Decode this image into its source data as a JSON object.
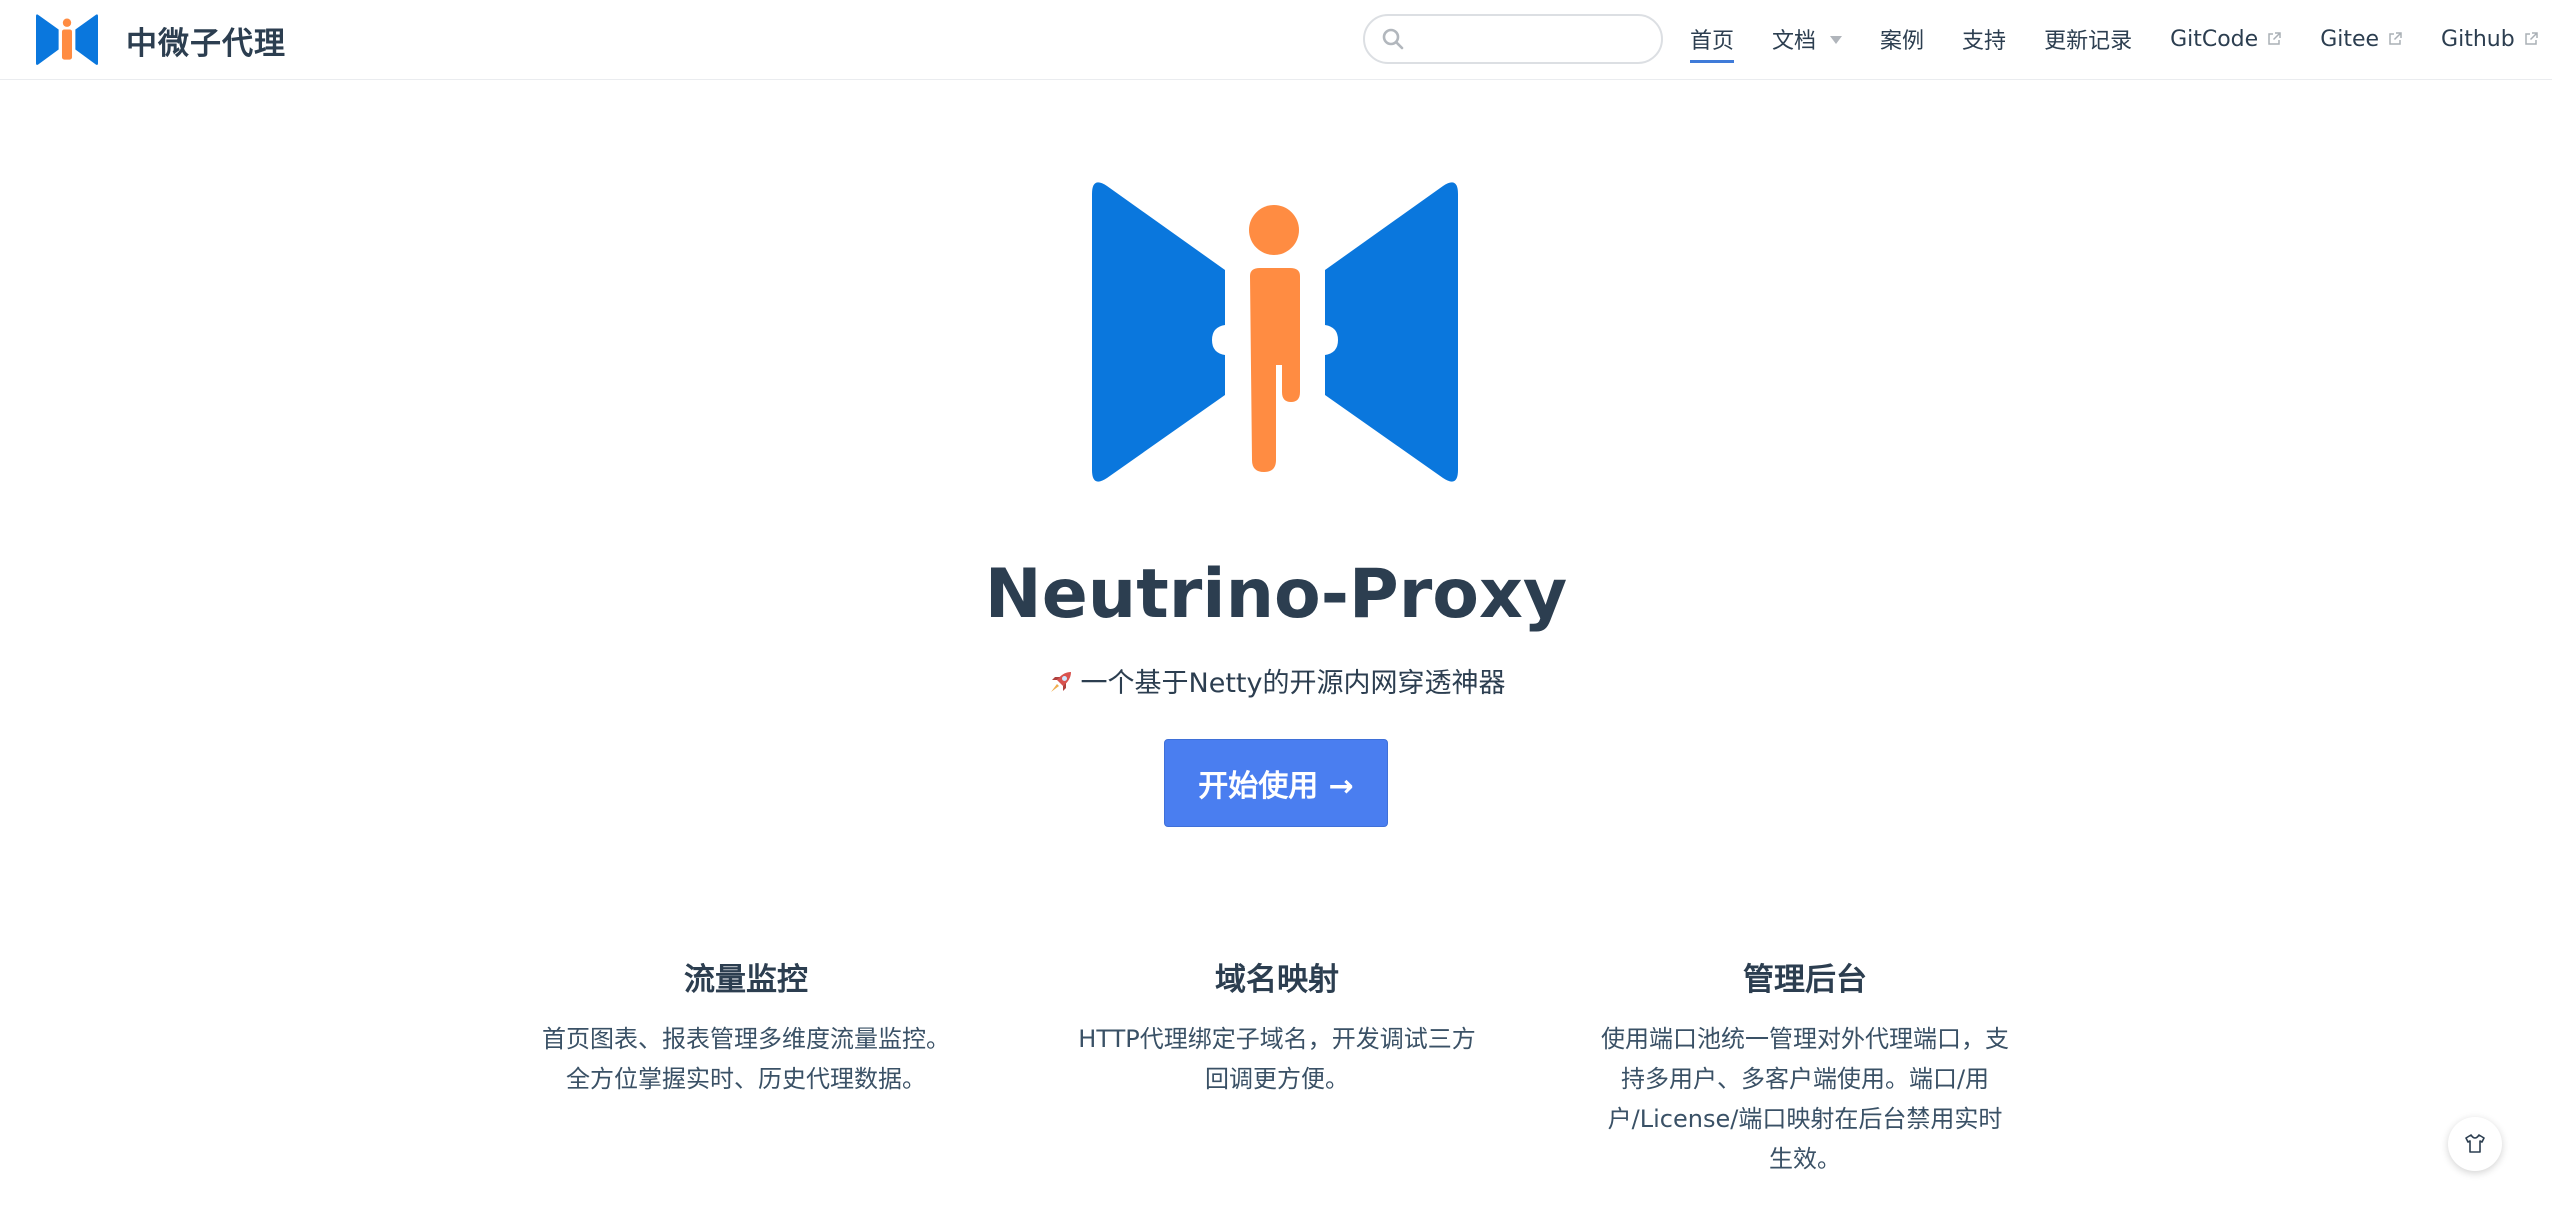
{
  "navbar": {
    "site_title": "中微子代理",
    "search": {
      "value": "",
      "placeholder": ""
    },
    "items": [
      {
        "label": "首页",
        "active": true
      },
      {
        "label": "文档",
        "dropdown": true
      },
      {
        "label": "案例"
      },
      {
        "label": "支持"
      },
      {
        "label": "更新记录"
      },
      {
        "label": "GitCode",
        "external": true
      },
      {
        "label": "Gitee",
        "external": true
      },
      {
        "label": "Github",
        "external": true
      }
    ]
  },
  "hero": {
    "title": "Neutrino-Proxy",
    "description": "一个基于Netty的开源内网穿透神器",
    "description_icon": "rocket-icon",
    "action_label": "开始使用 →"
  },
  "features": [
    {
      "title": "流量监控",
      "details": "首页图表、报表管理多维度流量监控。全方位掌握实时、历史代理数据。"
    },
    {
      "title": "域名映射",
      "details": "HTTP代理绑定子域名，开发调试三方回调更方便。"
    },
    {
      "title": "管理后台",
      "details": "使用端口池统一管理对外代理端口，支持多用户、多客户端使用。端口/用户/License/端口映射在后台禁用实时生效。"
    }
  ],
  "colors": {
    "brand_blue": "#0a77dd",
    "brand_orange": "#ff8c42",
    "cta_background": "#4a7ef0",
    "text": "#2c3e50"
  },
  "floating_button_icon": "shirt-icon"
}
